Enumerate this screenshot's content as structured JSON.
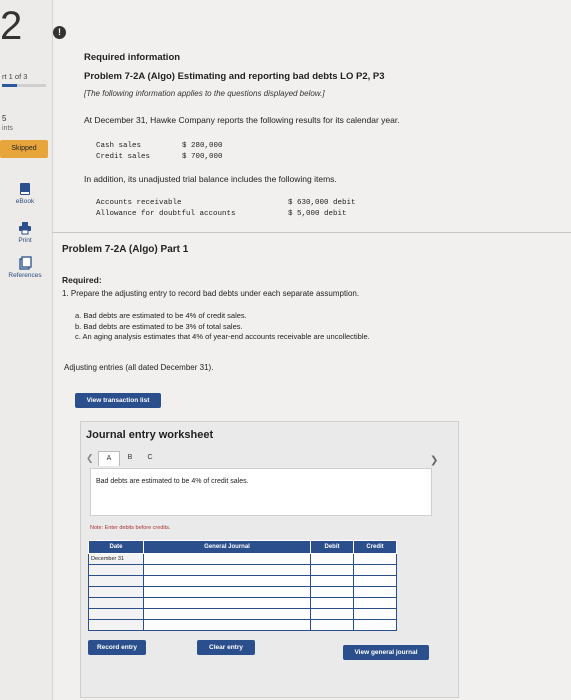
{
  "sidebar": {
    "question_number": "2",
    "part_label": "rt 1 of 3",
    "progress_fraction": 0.33,
    "points_number": "5",
    "points_label": "ints",
    "status_badge": "Skipped",
    "tools": [
      {
        "label": "eBook",
        "icon": "book-icon"
      },
      {
        "label": "Print",
        "icon": "printer-icon"
      },
      {
        "label": "References",
        "icon": "references-icon"
      }
    ]
  },
  "alert_icon": "!",
  "header": {
    "required_info": "Required information",
    "problem_title": "Problem 7-2A (Algo) Estimating and reporting bad debts LO P2, P3",
    "note": "[The following information applies to the questions displayed below.]",
    "intro": "At December 31, Hawke Company reports the following results for its calendar year."
  },
  "sales_table": [
    {
      "label": "Cash sales",
      "value": "$ 280,000"
    },
    {
      "label": "Credit sales",
      "value": "$ 700,000"
    }
  ],
  "trial_intro": "In addition, its unadjusted trial balance includes the following items.",
  "trial_table": [
    {
      "label": "Accounts receivable",
      "value": "$ 630,000 debit"
    },
    {
      "label": "Allowance for doubtful accounts",
      "value": "$ 5,000 debit"
    }
  ],
  "part": {
    "title": "Problem 7-2A (Algo) Part 1",
    "required_heading": "Required:",
    "required_text": "1. Prepare the adjusting entry to record bad debts under each separate assumption.",
    "assumptions": [
      "a. Bad debts are estimated to be 4% of credit sales.",
      "b. Bad debts are estimated to be 3% of total sales.",
      "c. An aging analysis estimates that 4% of year-end accounts receivable are uncollectible."
    ],
    "adjusting_note": "Adjusting entries (all dated December 31)."
  },
  "buttons": {
    "view_transaction_list": "View transaction list",
    "record_entry": "Record entry",
    "clear_entry": "Clear entry",
    "view_general_journal": "View general journal"
  },
  "worksheet": {
    "title": "Journal entry worksheet",
    "tabs": [
      "A",
      "B",
      "C"
    ],
    "active_tab": "A",
    "description": "Bad debts are estimated to be 4% of credit sales.",
    "note": "Note: Enter debits before credits.",
    "columns": [
      "Date",
      "General Journal",
      "Debit",
      "Credit"
    ],
    "rows": [
      {
        "date": "December 31",
        "account": "",
        "debit": "",
        "credit": ""
      },
      {
        "date": "",
        "account": "",
        "debit": "",
        "credit": ""
      },
      {
        "date": "",
        "account": "",
        "debit": "",
        "credit": ""
      },
      {
        "date": "",
        "account": "",
        "debit": "",
        "credit": ""
      },
      {
        "date": "",
        "account": "",
        "debit": "",
        "credit": ""
      },
      {
        "date": "",
        "account": "",
        "debit": "",
        "credit": ""
      },
      {
        "date": "",
        "account": "",
        "debit": "",
        "credit": ""
      }
    ]
  },
  "colors": {
    "primary": "#2b4f8c",
    "badge": "#e7a53b",
    "background": "#f1f0ee"
  }
}
